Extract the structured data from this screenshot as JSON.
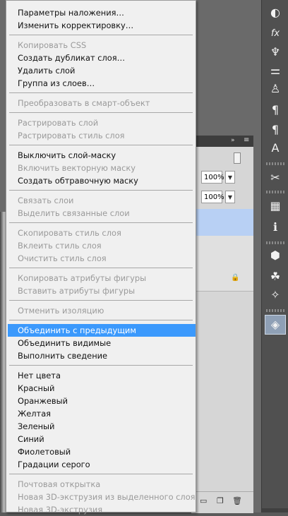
{
  "menu": {
    "items": [
      {
        "label": "Параметры наложения…",
        "enabled": true
      },
      {
        "label": "Изменить корректировку…",
        "enabled": true
      },
      {
        "label": "Копировать CSS",
        "enabled": false
      },
      {
        "label": "Создать дубликат слоя…",
        "enabled": true
      },
      {
        "label": "Удалить слой",
        "enabled": true
      },
      {
        "label": "Группа из слоев…",
        "enabled": true
      },
      {
        "label": "Преобразовать в смарт-объект",
        "enabled": false
      },
      {
        "label": "Растрировать слой",
        "enabled": false
      },
      {
        "label": "Растрировать стиль слоя",
        "enabled": false
      },
      {
        "label": "Выключить слой-маску",
        "enabled": true
      },
      {
        "label": "Включить векторную маску",
        "enabled": false
      },
      {
        "label": "Создать обтравочную маску",
        "enabled": true
      },
      {
        "label": "Связать слои",
        "enabled": false
      },
      {
        "label": "Выделить связанные слои",
        "enabled": false
      },
      {
        "label": "Скопировать стиль слоя",
        "enabled": false
      },
      {
        "label": "Вклеить стиль слоя",
        "enabled": false
      },
      {
        "label": "Очистить стиль слоя",
        "enabled": false
      },
      {
        "label": "Копировать атрибуты фигуры",
        "enabled": false
      },
      {
        "label": "Вставить атрибуты фигуры",
        "enabled": false
      },
      {
        "label": "Отменить изоляцию",
        "enabled": false
      },
      {
        "label": "Объединить с предыдущим",
        "enabled": true,
        "highlighted": true
      },
      {
        "label": "Объединить видимые",
        "enabled": true
      },
      {
        "label": "Выполнить сведение",
        "enabled": true
      },
      {
        "label": "Нет цвета",
        "enabled": true
      },
      {
        "label": "Красный",
        "enabled": true
      },
      {
        "label": "Оранжевый",
        "enabled": true
      },
      {
        "label": "Желтая",
        "enabled": true
      },
      {
        "label": "Зеленый",
        "enabled": true
      },
      {
        "label": "Синий",
        "enabled": true
      },
      {
        "label": "Фиолетовый",
        "enabled": true
      },
      {
        "label": "Градации серого",
        "enabled": true
      },
      {
        "label": "Почтовая открытка",
        "enabled": false
      },
      {
        "label": "Новая 3D-экструзия из выделенного слоя",
        "enabled": false
      },
      {
        "label": "Новая 3D-экструзия",
        "enabled": false
      }
    ]
  },
  "layers_panel": {
    "opacity_value": "100%",
    "fill_value": "100%",
    "collapse_glyph": "»",
    "menu_glyph": "≡",
    "dropdown_glyph": "▼",
    "lock_glyph": "🔒"
  },
  "dock": {
    "icons": [
      {
        "name": "adjustments-icon",
        "glyph": "◐"
      },
      {
        "name": "styles-fx-icon",
        "glyph": "fx"
      },
      {
        "name": "brush-presets-icon",
        "glyph": "♆"
      },
      {
        "name": "brush-icon",
        "glyph": "⚌"
      },
      {
        "name": "clone-source-icon",
        "glyph": "♙"
      },
      {
        "name": "paragraph-icon",
        "glyph": "¶"
      },
      {
        "name": "paragraph-styles-icon",
        "glyph": "¶"
      },
      {
        "name": "character-styles-icon",
        "glyph": "A"
      },
      {
        "name": "tools-icon",
        "glyph": "✂"
      },
      {
        "name": "channels-icon",
        "glyph": "▦"
      },
      {
        "name": "info-icon",
        "glyph": "ℹ"
      },
      {
        "name": "3d-icon",
        "glyph": "⬢"
      },
      {
        "name": "materials-icon",
        "glyph": "☘"
      },
      {
        "name": "paths-icon",
        "glyph": "✧"
      },
      {
        "name": "layers-icon",
        "glyph": "◈"
      }
    ]
  }
}
